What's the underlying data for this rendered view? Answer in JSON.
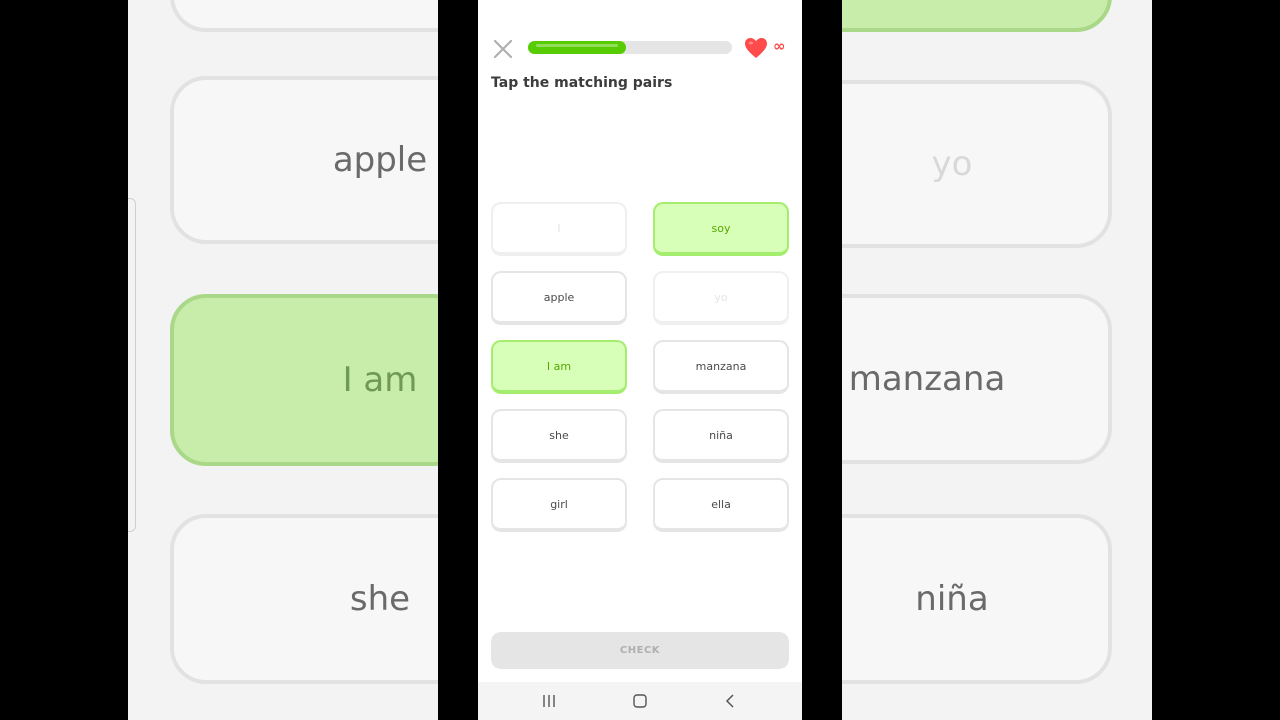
{
  "header": {
    "progress_fraction": 0.48,
    "hearts_label": "∞"
  },
  "prompt": "Tap the matching pairs",
  "tiles": {
    "left": [
      {
        "text": "I",
        "state": "matched"
      },
      {
        "text": "apple",
        "state": "default"
      },
      {
        "text": "I am",
        "state": "selected"
      },
      {
        "text": "she",
        "state": "default"
      },
      {
        "text": "girl",
        "state": "default"
      }
    ],
    "right": [
      {
        "text": "soy",
        "state": "selected"
      },
      {
        "text": "yo",
        "state": "matched"
      },
      {
        "text": "manzana",
        "state": "default"
      },
      {
        "text": "niña",
        "state": "default"
      },
      {
        "text": "ella",
        "state": "default"
      }
    ]
  },
  "check_label": "CHECK",
  "background": {
    "left_words": [
      "apple",
      "I am",
      "she"
    ],
    "right_words": [
      "yo",
      "manzana",
      "niña"
    ]
  },
  "colors": {
    "accent": "#58cc02",
    "selected_bg": "#d7ffb8",
    "heart": "#ff4b4b"
  },
  "icons": [
    "close-icon",
    "heart-icon",
    "recent-apps-icon",
    "home-icon",
    "back-icon"
  ]
}
